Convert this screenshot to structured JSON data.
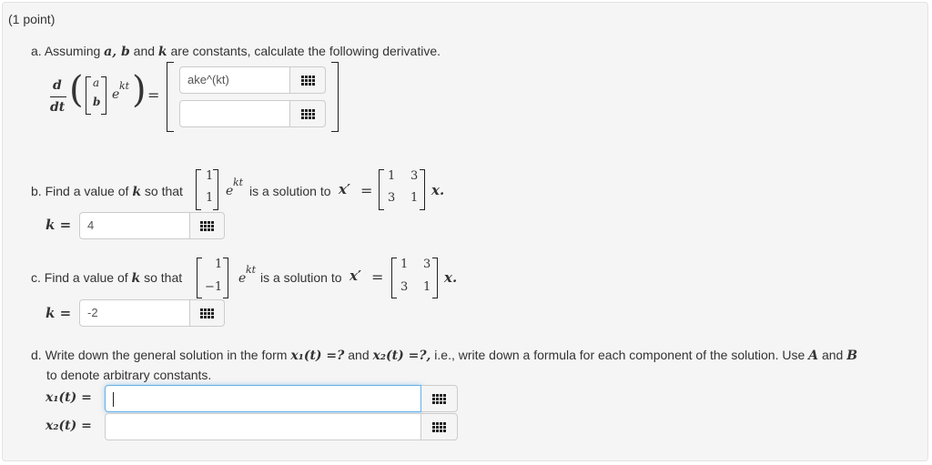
{
  "problem": {
    "points": "(1 point)",
    "a": {
      "label": "a.",
      "text1": "Assuming",
      "vars_ab": "a, b",
      "and": "and",
      "var_k": "k",
      "text2": "are constants, calculate the following derivative.",
      "d": "d",
      "dt": "dt",
      "vec_top": "a",
      "vec_bot": "b",
      "exp_e": "e",
      "exp_kt": "kt",
      "eq": "=",
      "input_top_value": "ake^(kt)",
      "input_bottom_value": ""
    },
    "b": {
      "label": "b.",
      "text1": "Find a value of",
      "var_k": "k",
      "text2": "so that",
      "vec": [
        "1",
        "1"
      ],
      "exp_e": "e",
      "exp_kt": "kt",
      "text3": "is a solution to",
      "xprime": "x′",
      "eq": "=",
      "matrix": [
        "1",
        "3",
        "3",
        "1"
      ],
      "xend": "x.",
      "k_label": "k =",
      "k_value": "4"
    },
    "c": {
      "label": "c.",
      "text1": "Find a value of",
      "var_k": "k",
      "text2": "so that",
      "vec": [
        "1",
        "−1"
      ],
      "exp_e": "e",
      "exp_kt": "kt",
      "text3": "is a solution to",
      "xprime": "x′",
      "eq": "=",
      "matrix": [
        "1",
        "3",
        "3",
        "1"
      ],
      "xend": "x.",
      "k_label": "k =",
      "k_value": "-2"
    },
    "d": {
      "label": "d.",
      "text1": "Write down the general solution in the form",
      "x1q": "x₁(t) =?",
      "and": "and",
      "x2q": "x₂(t) =?,",
      "text2": "i.e., write down a formula for each component of the solution. Use",
      "A": "A",
      "and2": "and",
      "B": "B",
      "text3": "to denote arbitrary constants.",
      "x1_label": "x₁(t) =",
      "x2_label": "x₂(t) =",
      "x1_value": "",
      "x2_value": ""
    }
  },
  "icons": {
    "palette": "grid-icon"
  }
}
